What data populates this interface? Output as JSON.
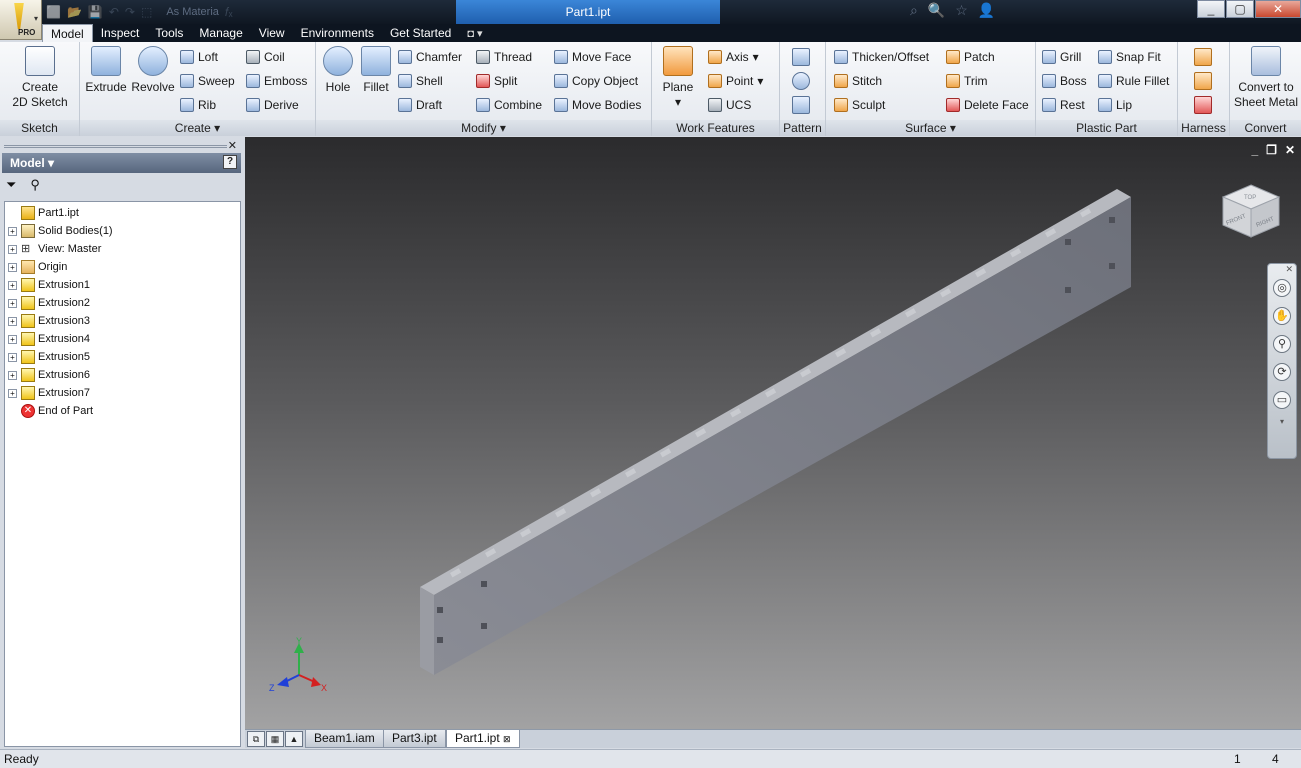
{
  "app": {
    "logo": "autodesk-inventor-logo",
    "edition": "PRO",
    "doc_title": "Part1.ipt",
    "material_placeholder": "As Materia"
  },
  "menu": {
    "tabs": [
      "Model",
      "Inspect",
      "Tools",
      "Manage",
      "View",
      "Environments",
      "Get Started"
    ],
    "active": "Model"
  },
  "ribbon": {
    "panels": {
      "sketch": "Sketch",
      "create": "Create",
      "modify": "Modify",
      "work": "Work Features",
      "pattern": "Pattern",
      "surface": "Surface",
      "plastic": "Plastic Part",
      "harness": "Harness",
      "convert": "Convert"
    },
    "sketch": {
      "create_l1": "Create",
      "create_l2": "2D Sketch"
    },
    "create": {
      "extrude": "Extrude",
      "revolve": "Revolve",
      "loft": "Loft",
      "sweep": "Sweep",
      "rib": "Rib",
      "coil": "Coil",
      "emboss": "Emboss",
      "derive": "Derive"
    },
    "modify": {
      "hole": "Hole",
      "fillet": "Fillet",
      "chamfer": "Chamfer",
      "shell": "Shell",
      "draft": "Draft",
      "thread": "Thread",
      "split": "Split",
      "combine": "Combine",
      "move_face": "Move Face",
      "copy_object": "Copy Object",
      "move_bodies": "Move Bodies"
    },
    "work": {
      "plane": "Plane",
      "axis": "Axis",
      "point": "Point",
      "ucs": "UCS"
    },
    "surface": {
      "thicken": "Thicken/Offset",
      "stitch": "Stitch",
      "sculpt": "Sculpt",
      "patch": "Patch",
      "trim": "Trim",
      "delete_face": "Delete Face"
    },
    "plastic": {
      "grill": "Grill",
      "boss": "Boss",
      "rest": "Rest",
      "snap_fit": "Snap Fit",
      "rule_fillet": "Rule Fillet",
      "lip": "Lip"
    },
    "convert": {
      "l1": "Convert to",
      "l2": "Sheet Metal"
    }
  },
  "browser": {
    "title": "Model",
    "help": "?",
    "tree": [
      {
        "label": "Part1.ipt",
        "icon": "part-icon",
        "expander": false
      },
      {
        "label": "Solid Bodies(1)",
        "icon": "solid-bodies-icon",
        "expander": true
      },
      {
        "label": "View: Master",
        "icon": "view-icon",
        "expander": true
      },
      {
        "label": "Origin",
        "icon": "folder-icon",
        "expander": true
      },
      {
        "label": "Extrusion1",
        "icon": "extrusion-icon",
        "expander": true
      },
      {
        "label": "Extrusion2",
        "icon": "extrusion-icon",
        "expander": true
      },
      {
        "label": "Extrusion3",
        "icon": "extrusion-icon",
        "expander": true
      },
      {
        "label": "Extrusion4",
        "icon": "extrusion-icon",
        "expander": true
      },
      {
        "label": "Extrusion5",
        "icon": "extrusion-icon",
        "expander": true
      },
      {
        "label": "Extrusion6",
        "icon": "extrusion-icon",
        "expander": true
      },
      {
        "label": "Extrusion7",
        "icon": "extrusion-icon",
        "expander": true
      },
      {
        "label": "End of Part",
        "icon": "end-of-part-icon",
        "expander": false
      }
    ]
  },
  "viewcube": {
    "front": "FRONT",
    "right": "RIGHT",
    "top": "TOP"
  },
  "axes": {
    "x": "X",
    "y": "Y",
    "z": "Z"
  },
  "doc_tabs": [
    "Beam1.iam",
    "Part3.ipt",
    "Part1.ipt"
  ],
  "active_doc_tab": "Part1.ipt",
  "status": {
    "text": "Ready",
    "n1": "1",
    "n2": "4"
  },
  "colors": {
    "title_active": "#2a6fc4",
    "viewport_top": "#2b2b2d",
    "viewport_bottom": "#a2a2a3",
    "part_face": "#7a7d87"
  }
}
